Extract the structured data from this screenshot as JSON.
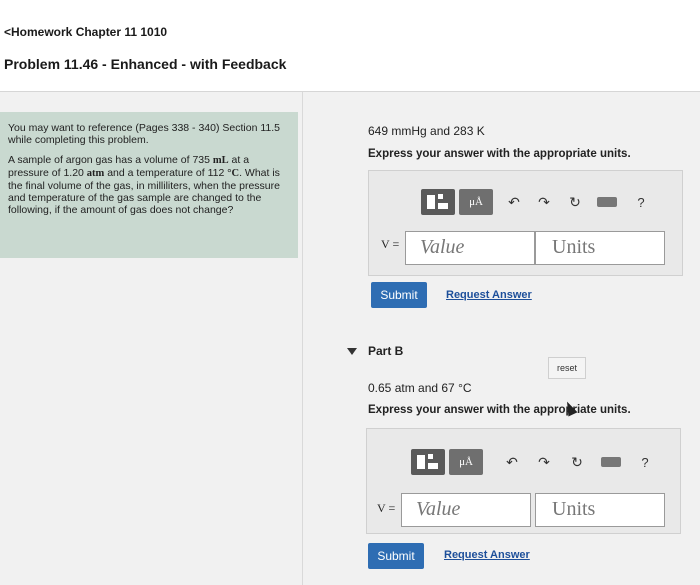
{
  "header": {
    "back_label": "<Homework Chapter 11 1010",
    "title": "Problem 11.46 - Enhanced - with Feedback"
  },
  "info": {
    "reference": "You may want to reference (Pages 338 - 340) Section 11.5 while completing this problem.",
    "question_parts": {
      "q1": "A sample of argon gas has a volume of 735 ",
      "unit_ml": "mL",
      "q2": " at a pressure of 1.20 ",
      "unit_atm": "atm",
      "q3": " and a temperature of 112 ",
      "unit_c": "°C",
      "q4": ". What is the final volume of the gas, in milliliters, when the pressure and temperature of the gas sample are changed to the following, if the amount of gas does not change?"
    }
  },
  "part_a": {
    "given": "649 mmHg and 283 K",
    "instruction": "Express your answer with the appropriate units.",
    "var_label": "V =",
    "value_placeholder": "Value",
    "units_placeholder": "Units",
    "submit": "Submit",
    "request": "Request Answer"
  },
  "part_b": {
    "title": "Part B",
    "reset": "reset",
    "given": "0.65 atm and 67 °C",
    "instruction": "Express your answer with the appropriate units.",
    "var_label": "V =",
    "value_placeholder": "Value",
    "units_placeholder": "Units",
    "submit": "Submit",
    "request": "Request Answer"
  },
  "toolbar": {
    "mu_label": "μÅ",
    "help": "?"
  },
  "colors": {
    "info_bg": "#c9d9d0",
    "submit_bg": "#2e6db3",
    "link": "#1d4f9a"
  }
}
